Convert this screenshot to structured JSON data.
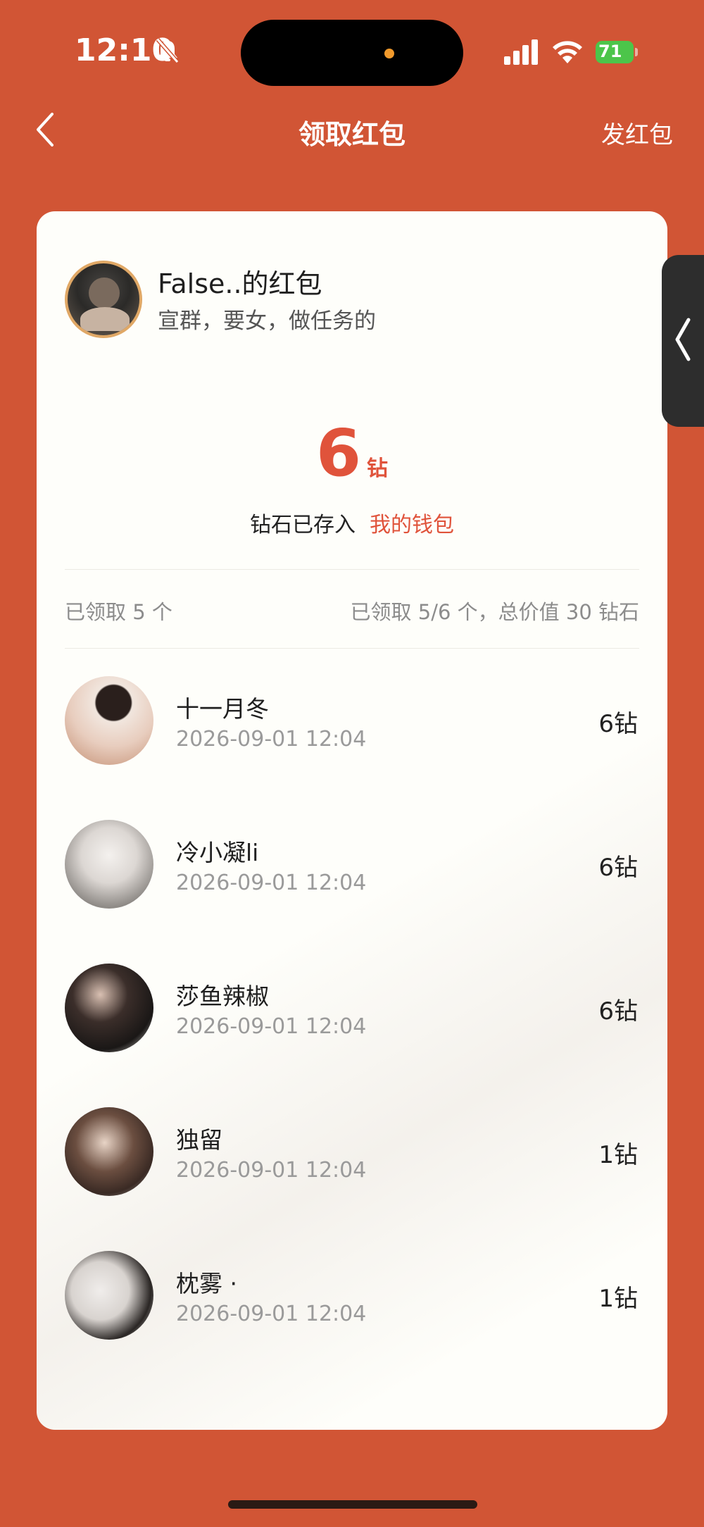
{
  "status_bar": {
    "time": "12:10",
    "battery": "71"
  },
  "nav": {
    "title": "领取红包",
    "action": "发红包"
  },
  "sender": {
    "name": "False..的红包",
    "description": "宣群，要女，做任务的"
  },
  "received": {
    "amount": "6",
    "unit": "钻",
    "deposit_text": "钻石已存入",
    "wallet_link": "我的钱包"
  },
  "summary": {
    "left": "已领取 5 个",
    "right": "已领取 5/6 个，总价值 30 钻石"
  },
  "claims": [
    {
      "name": "十一月冬",
      "time": "2026-09-01 12:04",
      "amount": "6钻"
    },
    {
      "name": "冷小凝li",
      "time": "2026-09-01 12:04",
      "amount": "6钻"
    },
    {
      "name": "莎鱼辣椒",
      "time": "2026-09-01 12:04",
      "amount": "6钻"
    },
    {
      "name": "独留",
      "time": "2026-09-01 12:04",
      "amount": "1钻"
    },
    {
      "name": "枕雾 ·",
      "time": "2026-09-01 12:04",
      "amount": "1钻"
    }
  ],
  "colors": {
    "background": "#D15535",
    "accent": "#E0533B",
    "card": "#FEFEFA"
  }
}
